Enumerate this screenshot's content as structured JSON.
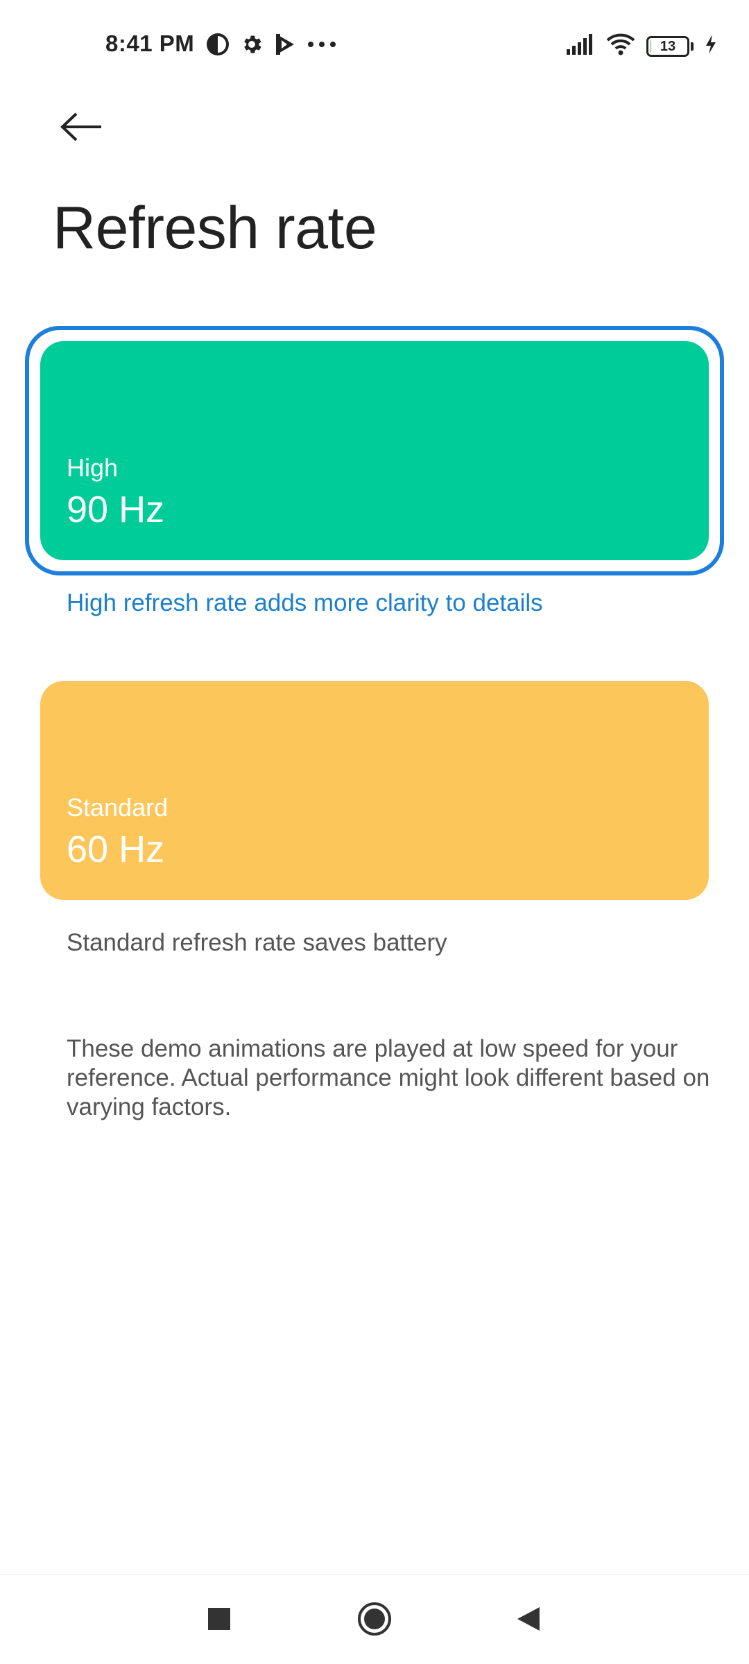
{
  "status_bar": {
    "time": "8:41 PM",
    "left_icons": [
      "notification-app-icon",
      "gear-icon",
      "play-icon",
      "more-dots-icon"
    ],
    "right_icons": [
      "signal-icon",
      "wifi-icon",
      "battery-icon",
      "charging-icon"
    ],
    "battery_level": "13",
    "battery_fraction": 0.13
  },
  "header": {
    "back_icon": "arrow-left-icon",
    "title": "Refresh rate"
  },
  "options": [
    {
      "label": "High",
      "value": "90 Hz",
      "description": "High refresh rate adds more clarity to details",
      "selected": true,
      "color": "#00cc9a",
      "description_color": "#1b7fc9"
    },
    {
      "label": "Standard",
      "value": "60 Hz",
      "description": "Standard refresh rate saves battery",
      "selected": false,
      "color": "#fdc65a",
      "description_color": "#555555"
    }
  ],
  "info": "These demo animations are played at low speed for your reference. Actual performance might look different based on varying factors.",
  "nav_bar": {
    "icons": [
      "recents-square-icon",
      "home-circle-icon",
      "back-triangle-icon"
    ]
  },
  "colors": {
    "selection_outline": "#1b7fdb",
    "high_card": "#00cc9a",
    "standard_card": "#fdc65a",
    "link_blue": "#1b7fc9"
  }
}
